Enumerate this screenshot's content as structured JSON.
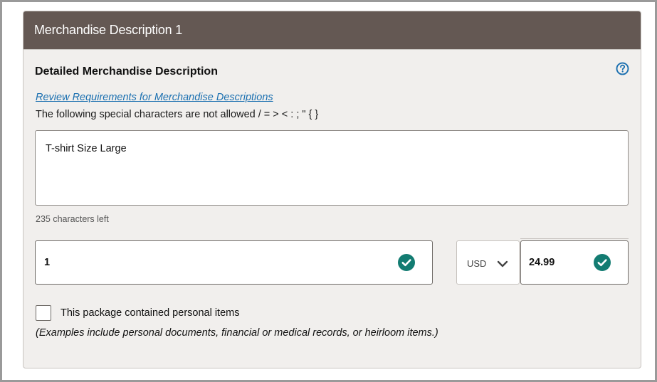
{
  "card": {
    "title": "Merchandise Description 1"
  },
  "section": {
    "title": "Detailed Merchandise Description",
    "help_icon": "question-circle-icon"
  },
  "requirements_link": "Review Requirements for Merchandise Descriptions",
  "special_chars_note": "The following special characters are not allowed / = > < : ; \" { }",
  "description": {
    "value": "T-shirt Size Large",
    "chars_left": "235 characters left"
  },
  "quantity": {
    "value": "1",
    "status_icon": "check-circle-icon"
  },
  "currency": {
    "selected": "USD",
    "icon": "chevron-down-icon"
  },
  "unit_value": {
    "value": "24.99",
    "status_icon": "check-circle-icon"
  },
  "personal_items": {
    "label": "This package contained personal items",
    "checked": false,
    "note": "(Examples include personal documents, financial or medical records, or heirloom items.)"
  },
  "colors": {
    "header_bg": "#645853",
    "card_bg": "#f1efed",
    "link": "#1a6fb0",
    "check": "#137c72",
    "help": "#1a6fb0"
  }
}
